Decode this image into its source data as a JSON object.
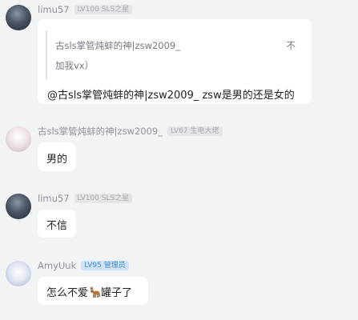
{
  "messages": [
    {
      "nick": "limu57",
      "badge": "LV100 SLS之星",
      "quote": {
        "line1": "古sls掌管炖蚌的神|zsw2009_",
        "tail": "不",
        "line2": "加我vx）"
      },
      "text": "@古sls掌管炖蚌的神|zsw2009_ zsw是男的还是女的"
    },
    {
      "nick": "古sls掌管炖蚌的神|zsw2009_",
      "badge": "LV67 生电大佬",
      "text": "男的"
    },
    {
      "nick": "limu57",
      "badge": "LV100 SLS之星",
      "text": "不信"
    },
    {
      "nick": "AmyUuk",
      "badge": "LV95 管理员",
      "text_before": "怎么不爱",
      "emoji": "deer-icon",
      "text_after": "罐子了"
    }
  ],
  "colors": {
    "background": "#f2f3f5",
    "bubble": "#ffffff",
    "admin_badge": "#cfe4fb",
    "admin_badge_text": "#4a8ad6"
  }
}
